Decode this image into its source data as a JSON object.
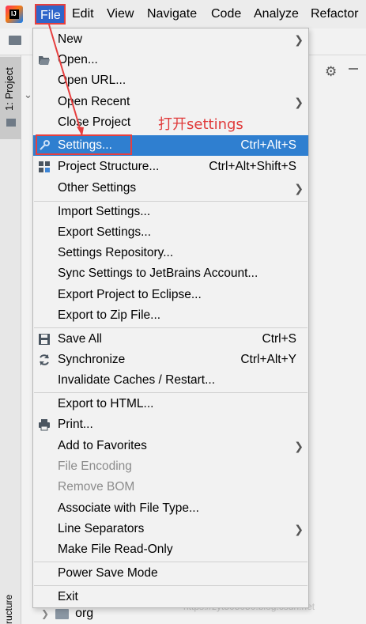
{
  "menubar": {
    "items": [
      "File",
      "Edit",
      "View",
      "Navigate",
      "Code",
      "Analyze",
      "Refactor"
    ]
  },
  "sidebar": {
    "project_tab": "1: Project",
    "structure_tab": "ructure"
  },
  "tree": {
    "folder": "org"
  },
  "watermark": "https://zyt505050.blog.csdn.net",
  "annotation": "打开settings",
  "file_menu": {
    "new": "New",
    "open": "Open...",
    "open_url": "Open URL...",
    "open_recent": "Open Recent",
    "close_project": "Close Project",
    "settings": "Settings...",
    "settings_shortcut": "Ctrl+Alt+S",
    "project_structure": "Project Structure...",
    "project_structure_shortcut": "Ctrl+Alt+Shift+S",
    "other_settings": "Other Settings",
    "import_settings": "Import Settings...",
    "export_settings": "Export Settings...",
    "settings_repository": "Settings Repository...",
    "sync_settings": "Sync Settings to JetBrains Account...",
    "export_eclipse": "Export Project to Eclipse...",
    "export_zip": "Export to Zip File...",
    "save_all": "Save All",
    "save_all_shortcut": "Ctrl+S",
    "synchronize": "Synchronize",
    "synchronize_shortcut": "Ctrl+Alt+Y",
    "invalidate_caches": "Invalidate Caches / Restart...",
    "export_html": "Export to HTML...",
    "print": "Print...",
    "add_favorites": "Add to Favorites",
    "file_encoding": "File Encoding",
    "remove_bom": "Remove BOM",
    "associate_file_type": "Associate with File Type...",
    "line_separators": "Line Separators",
    "make_read_only": "Make File Read-Only",
    "power_save": "Power Save Mode",
    "exit": "Exit"
  },
  "colors": {
    "selection": "#2f7fd0",
    "annotation_red": "#e63f3f",
    "menu_bg": "#f2f2f2"
  }
}
